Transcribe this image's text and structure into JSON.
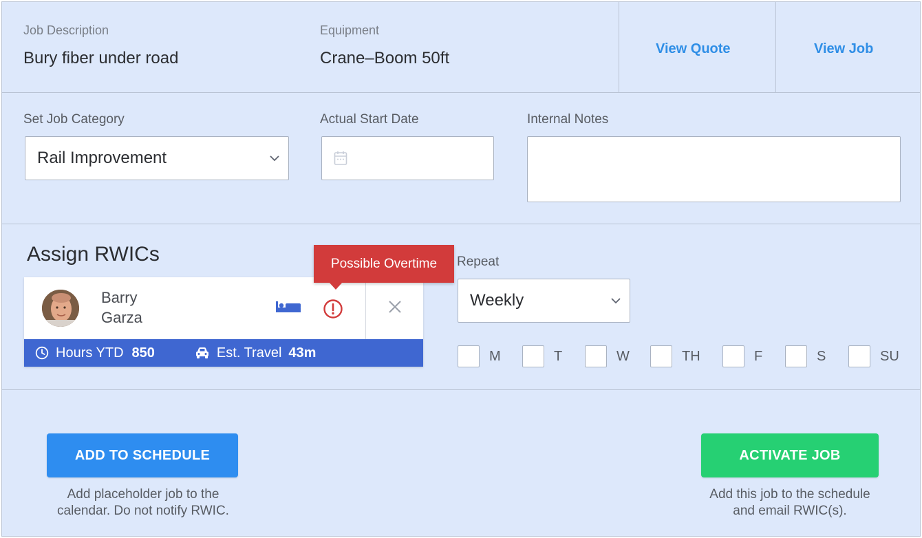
{
  "job": {
    "description_label": "Job Description",
    "description_value": "Bury fiber under road",
    "equipment_label": "Equipment",
    "equipment_value": "Crane–Boom 50ft",
    "view_quote": "View Quote",
    "view_job": "View Job"
  },
  "form": {
    "category_label": "Set Job Category",
    "category_value": "Rail Improvement",
    "start_date_label": "Actual Start Date",
    "start_date_value": "",
    "notes_label": "Internal Notes",
    "notes_value": ""
  },
  "assign": {
    "title": "Assign RWICs",
    "tooltip": "Possible Overtime",
    "rwic": {
      "first_name": "Barry",
      "last_name": "Garza",
      "hours_label": "Hours YTD",
      "hours_value": "850",
      "travel_label": "Est. Travel",
      "travel_value": "43m"
    }
  },
  "repeat": {
    "label": "Repeat",
    "value": "Weekly",
    "days": [
      "M",
      "T",
      "W",
      "TH",
      "F",
      "S",
      "SU"
    ]
  },
  "actions": {
    "add_schedule": "ADD TO SCHEDULE",
    "add_schedule_help_1": "Add placeholder job to the",
    "add_schedule_help_2": "calendar. Do not notify RWIC.",
    "activate": "ACTIVATE JOB",
    "activate_help_1": "Add this job to the schedule",
    "activate_help_2": "and email RWIC(s)."
  },
  "colors": {
    "panel": "#dde8fb",
    "link": "#2f8ee6",
    "card_footer": "#3f67d1",
    "tooltip": "#d23b3b",
    "add_button": "#2e8df0",
    "activate_button": "#26d073"
  }
}
